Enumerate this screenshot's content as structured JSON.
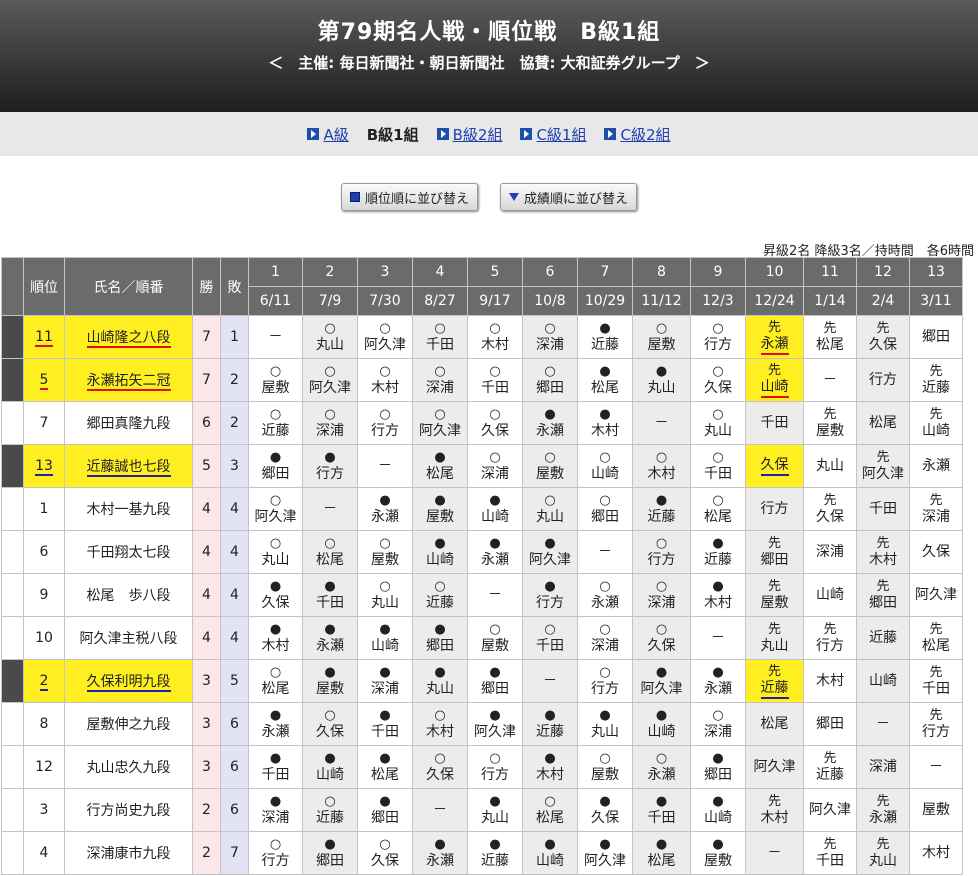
{
  "header": {
    "title": "第79期名人戦・順位戦　B級1組",
    "subtitle": "＜　主催: 毎日新聞社・朝日新聞社　協賛: 大和証券グループ　＞"
  },
  "nav": [
    {
      "label": "A級",
      "link": true
    },
    {
      "label": "B級1組",
      "link": false
    },
    {
      "label": "B級2組",
      "link": true
    },
    {
      "label": "C級1組",
      "link": true
    },
    {
      "label": "C級2組",
      "link": true
    }
  ],
  "sort_buttons": {
    "rank_label": "順位順に並び替え",
    "score_label": "成績順に並び替え"
  },
  "note": "昇級2名 降級3名／持時間　各6時間",
  "table": {
    "headers": {
      "rank": "順位",
      "name": "氏名／順番",
      "win": "勝",
      "loss": "敗"
    },
    "rounds": [
      "1",
      "2",
      "3",
      "4",
      "5",
      "6",
      "7",
      "8",
      "9",
      "10",
      "11",
      "12",
      "13"
    ],
    "dates": [
      "6/11",
      "7/9",
      "7/30",
      "8/27",
      "9/17",
      "10/8",
      "10/29",
      "11/12",
      "12/3",
      "12/24",
      "1/14",
      "2/4",
      "3/11"
    ],
    "rows": [
      {
        "rank": "11",
        "name": "山崎隆之八段",
        "win": "7",
        "loss": "1",
        "hl": "red",
        "cells": [
          [
            "",
            "－"
          ],
          [
            "○",
            "丸山"
          ],
          [
            "○",
            "阿久津"
          ],
          [
            "○",
            "千田"
          ],
          [
            "○",
            "木村"
          ],
          [
            "○",
            "深浦"
          ],
          [
            "●",
            "近藤"
          ],
          [
            "○",
            "屋敷"
          ],
          [
            "○",
            "行方"
          ],
          [
            "先",
            "永瀬"
          ],
          [
            "先",
            "松尾"
          ],
          [
            "先",
            "久保"
          ],
          [
            "",
            "郷田"
          ]
        ]
      },
      {
        "rank": "5",
        "name": "永瀬拓矢二冠",
        "win": "7",
        "loss": "2",
        "hl": "red",
        "cells": [
          [
            "○",
            "屋敷"
          ],
          [
            "○",
            "阿久津"
          ],
          [
            "○",
            "木村"
          ],
          [
            "○",
            "深浦"
          ],
          [
            "○",
            "千田"
          ],
          [
            "○",
            "郷田"
          ],
          [
            "●",
            "松尾"
          ],
          [
            "●",
            "丸山"
          ],
          [
            "○",
            "久保"
          ],
          [
            "先",
            "山崎"
          ],
          [
            "",
            "－"
          ],
          [
            "",
            "行方"
          ],
          [
            "先",
            "近藤"
          ]
        ]
      },
      {
        "rank": "7",
        "name": "郷田真隆九段",
        "win": "6",
        "loss": "2",
        "hl": "",
        "cells": [
          [
            "○",
            "近藤"
          ],
          [
            "○",
            "深浦"
          ],
          [
            "○",
            "行方"
          ],
          [
            "○",
            "阿久津"
          ],
          [
            "○",
            "久保"
          ],
          [
            "●",
            "永瀬"
          ],
          [
            "●",
            "木村"
          ],
          [
            "",
            "－"
          ],
          [
            "○",
            "丸山"
          ],
          [
            "",
            "千田"
          ],
          [
            "先",
            "屋敷"
          ],
          [
            "",
            "松尾"
          ],
          [
            "先",
            "山崎"
          ]
        ]
      },
      {
        "rank": "13",
        "name": "近藤誠也七段",
        "win": "5",
        "loss": "3",
        "hl": "blue",
        "cells": [
          [
            "●",
            "郷田"
          ],
          [
            "●",
            "行方"
          ],
          [
            "",
            "－"
          ],
          [
            "●",
            "松尾"
          ],
          [
            "○",
            "深浦"
          ],
          [
            "○",
            "屋敷"
          ],
          [
            "○",
            "山崎"
          ],
          [
            "○",
            "木村"
          ],
          [
            "○",
            "千田"
          ],
          [
            "",
            "久保"
          ],
          [
            "",
            "丸山"
          ],
          [
            "先",
            "阿久津"
          ],
          [
            "",
            "永瀬"
          ]
        ]
      },
      {
        "rank": "1",
        "name": "木村一基九段",
        "win": "4",
        "loss": "4",
        "hl": "",
        "cells": [
          [
            "○",
            "阿久津"
          ],
          [
            "",
            "－"
          ],
          [
            "●",
            "永瀬"
          ],
          [
            "●",
            "屋敷"
          ],
          [
            "●",
            "山崎"
          ],
          [
            "○",
            "丸山"
          ],
          [
            "○",
            "郷田"
          ],
          [
            "●",
            "近藤"
          ],
          [
            "○",
            "松尾"
          ],
          [
            "",
            "行方"
          ],
          [
            "先",
            "久保"
          ],
          [
            "",
            "千田"
          ],
          [
            "先",
            "深浦"
          ]
        ]
      },
      {
        "rank": "6",
        "name": "千田翔太七段",
        "win": "4",
        "loss": "4",
        "hl": "",
        "cells": [
          [
            "○",
            "丸山"
          ],
          [
            "○",
            "松尾"
          ],
          [
            "○",
            "屋敷"
          ],
          [
            "●",
            "山崎"
          ],
          [
            "●",
            "永瀬"
          ],
          [
            "●",
            "阿久津"
          ],
          [
            "",
            "－"
          ],
          [
            "○",
            "行方"
          ],
          [
            "●",
            "近藤"
          ],
          [
            "先",
            "郷田"
          ],
          [
            "",
            "深浦"
          ],
          [
            "先",
            "木村"
          ],
          [
            "",
            "久保"
          ]
        ]
      },
      {
        "rank": "9",
        "name": "松尾　歩八段",
        "win": "4",
        "loss": "4",
        "hl": "",
        "cells": [
          [
            "●",
            "久保"
          ],
          [
            "●",
            "千田"
          ],
          [
            "○",
            "丸山"
          ],
          [
            "○",
            "近藤"
          ],
          [
            "",
            "－"
          ],
          [
            "●",
            "行方"
          ],
          [
            "○",
            "永瀬"
          ],
          [
            "○",
            "深浦"
          ],
          [
            "●",
            "木村"
          ],
          [
            "先",
            "屋敷"
          ],
          [
            "",
            "山崎"
          ],
          [
            "先",
            "郷田"
          ],
          [
            "",
            "阿久津"
          ]
        ]
      },
      {
        "rank": "10",
        "name": "阿久津主税八段",
        "win": "4",
        "loss": "4",
        "hl": "",
        "cells": [
          [
            "●",
            "木村"
          ],
          [
            "●",
            "永瀬"
          ],
          [
            "●",
            "山崎"
          ],
          [
            "●",
            "郷田"
          ],
          [
            "○",
            "屋敷"
          ],
          [
            "○",
            "千田"
          ],
          [
            "○",
            "深浦"
          ],
          [
            "○",
            "久保"
          ],
          [
            "",
            "－"
          ],
          [
            "先",
            "丸山"
          ],
          [
            "先",
            "行方"
          ],
          [
            "",
            "近藤"
          ],
          [
            "先",
            "松尾"
          ]
        ]
      },
      {
        "rank": "2",
        "name": "久保利明九段",
        "win": "3",
        "loss": "5",
        "hl": "blue",
        "cells": [
          [
            "○",
            "松尾"
          ],
          [
            "●",
            "屋敷"
          ],
          [
            "●",
            "深浦"
          ],
          [
            "●",
            "丸山"
          ],
          [
            "●",
            "郷田"
          ],
          [
            "",
            "－"
          ],
          [
            "○",
            "行方"
          ],
          [
            "●",
            "阿久津"
          ],
          [
            "●",
            "永瀬"
          ],
          [
            "先",
            "近藤"
          ],
          [
            "",
            "木村"
          ],
          [
            "",
            "山崎"
          ],
          [
            "先",
            "千田"
          ]
        ]
      },
      {
        "rank": "8",
        "name": "屋敷伸之九段",
        "win": "3",
        "loss": "6",
        "hl": "",
        "cells": [
          [
            "●",
            "永瀬"
          ],
          [
            "○",
            "久保"
          ],
          [
            "●",
            "千田"
          ],
          [
            "○",
            "木村"
          ],
          [
            "●",
            "阿久津"
          ],
          [
            "●",
            "近藤"
          ],
          [
            "●",
            "丸山"
          ],
          [
            "●",
            "山崎"
          ],
          [
            "○",
            "深浦"
          ],
          [
            "",
            "松尾"
          ],
          [
            "",
            "郷田"
          ],
          [
            "",
            "－"
          ],
          [
            "先",
            "行方"
          ]
        ]
      },
      {
        "rank": "12",
        "name": "丸山忠久九段",
        "win": "3",
        "loss": "6",
        "hl": "",
        "cells": [
          [
            "●",
            "千田"
          ],
          [
            "●",
            "山崎"
          ],
          [
            "●",
            "松尾"
          ],
          [
            "○",
            "久保"
          ],
          [
            "○",
            "行方"
          ],
          [
            "●",
            "木村"
          ],
          [
            "○",
            "屋敷"
          ],
          [
            "○",
            "永瀬"
          ],
          [
            "●",
            "郷田"
          ],
          [
            "",
            "阿久津"
          ],
          [
            "先",
            "近藤"
          ],
          [
            "",
            "深浦"
          ],
          [
            "",
            "－"
          ]
        ]
      },
      {
        "rank": "3",
        "name": "行方尚史九段",
        "win": "2",
        "loss": "6",
        "hl": "",
        "cells": [
          [
            "●",
            "深浦"
          ],
          [
            "○",
            "近藤"
          ],
          [
            "●",
            "郷田"
          ],
          [
            "",
            "－"
          ],
          [
            "●",
            "丸山"
          ],
          [
            "○",
            "松尾"
          ],
          [
            "●",
            "久保"
          ],
          [
            "●",
            "千田"
          ],
          [
            "●",
            "山崎"
          ],
          [
            "先",
            "木村"
          ],
          [
            "",
            "阿久津"
          ],
          [
            "先",
            "永瀬"
          ],
          [
            "",
            "屋敷"
          ]
        ]
      },
      {
        "rank": "4",
        "name": "深浦康市九段",
        "win": "2",
        "loss": "7",
        "hl": "",
        "cells": [
          [
            "○",
            "行方"
          ],
          [
            "●",
            "郷田"
          ],
          [
            "○",
            "久保"
          ],
          [
            "●",
            "永瀬"
          ],
          [
            "●",
            "近藤"
          ],
          [
            "●",
            "山崎"
          ],
          [
            "●",
            "阿久津"
          ],
          [
            "●",
            "松尾"
          ],
          [
            "●",
            "屋敷"
          ],
          [
            "",
            "－"
          ],
          [
            "先",
            "千田"
          ],
          [
            "先",
            "丸山"
          ],
          [
            "",
            "木村"
          ]
        ]
      }
    ]
  },
  "highlights": {
    "r0c9": "red",
    "r1c9": "red",
    "r3c9": "blue",
    "r8c9": "blue"
  }
}
